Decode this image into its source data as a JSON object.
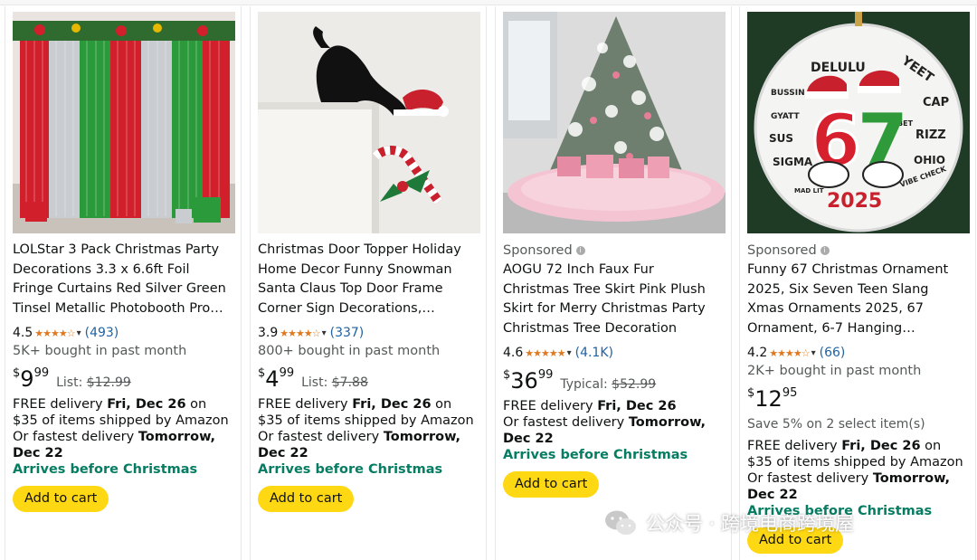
{
  "products": [
    {
      "sponsored": "",
      "title": "LOLStar 3 Pack Christmas Party Decorations 3.3 x 6.6ft Foil Fringe Curtains Red Silver Green Tinsel Metallic Photobooth Pro…",
      "rating": "4.5",
      "rating_count": "(493)",
      "bought": "5K+ bought in past month",
      "price_symbol": "$",
      "price_whole": "9",
      "price_fraction": "99",
      "list_label": "List:",
      "list_price": "$12.99",
      "save_text": "",
      "delivery_prefix": "FREE delivery ",
      "delivery_date": "Fri, Dec 26",
      "delivery_suffix": " on $35 of items shipped by Amazon",
      "fastest_prefix": "Or fastest delivery ",
      "fastest_date": "Tomorrow, Dec 22",
      "arrives": "Arrives before Christmas",
      "button": "Add to cart"
    },
    {
      "sponsored": "",
      "title": "Christmas Door Topper Holiday Home Decor Funny Snowman Santa Claus Top Door Frame Corner Sign Decorations,…",
      "rating": "3.9",
      "rating_count": "(337)",
      "bought": "800+ bought in past month",
      "price_symbol": "$",
      "price_whole": "4",
      "price_fraction": "99",
      "list_label": "List:",
      "list_price": "$7.88",
      "save_text": "",
      "delivery_prefix": "FREE delivery ",
      "delivery_date": "Fri, Dec 26",
      "delivery_suffix": " on $35 of items shipped by Amazon",
      "fastest_prefix": "Or fastest delivery ",
      "fastest_date": "Tomorrow, Dec 22",
      "arrives": "Arrives before Christmas",
      "button": "Add to cart"
    },
    {
      "sponsored": "Sponsored",
      "title": "AOGU 72 Inch Faux Fur Christmas Tree Skirt Pink Plush Skirt for Merry Christmas Party Christmas Tree Decoration",
      "rating": "4.6",
      "rating_count": "(4.1K)",
      "bought": "",
      "price_symbol": "$",
      "price_whole": "36",
      "price_fraction": "99",
      "list_label": "Typical:",
      "list_price": "$52.99",
      "save_text": "",
      "delivery_prefix": "FREE delivery ",
      "delivery_date": "Fri, Dec 26",
      "delivery_suffix": "",
      "fastest_prefix": "Or fastest delivery ",
      "fastest_date": "Tomorrow, Dec 22",
      "arrives": "Arrives before Christmas",
      "button": "Add to cart"
    },
    {
      "sponsored": "Sponsored",
      "title": "Funny 67 Christmas Ornament 2025, Six Seven Teen Slang Xmas Ornaments 2025, 67 Ornament, 6-7 Hanging…",
      "rating": "4.2",
      "rating_count": "(66)",
      "bought": "2K+ bought in past month",
      "price_symbol": "$",
      "price_whole": "12",
      "price_fraction": "95",
      "list_label": "",
      "list_price": "",
      "save_text": "Save 5% on 2 select item(s)",
      "delivery_prefix": "FREE delivery ",
      "delivery_date": "Fri, Dec 26",
      "delivery_suffix": " on $35 of items shipped by Amazon",
      "fastest_prefix": "Or fastest delivery ",
      "fastest_date": "Tomorrow, Dec 22",
      "arrives": "Arrives before Christmas",
      "button": "Add to cart"
    }
  ],
  "ornament_words": [
    "DELULU",
    "YEET",
    "BUSSIN",
    "CAP",
    "GYATT",
    "BET",
    "SUS",
    "RIZZ",
    "SIGMA",
    "OHIO",
    "VIBE CHECK",
    "MAD LIT",
    "2025"
  ],
  "watermark": "公众号 · 跨境电商跨境屋",
  "colors": {
    "button": "#ffd814",
    "stars": "#de7921",
    "link": "#2162a1",
    "arrives": "#067d62"
  }
}
